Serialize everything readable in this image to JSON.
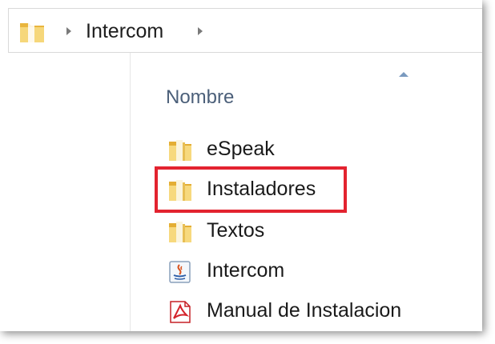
{
  "breadcrumb": {
    "current": "Intercom"
  },
  "list": {
    "column_header": "Nombre",
    "items": [
      {
        "name": "eSpeak",
        "icon": "folder-icon"
      },
      {
        "name": "Instaladores",
        "icon": "folder-icon",
        "highlighted": true
      },
      {
        "name": "Textos",
        "icon": "folder-icon"
      },
      {
        "name": "Intercom",
        "icon": "java-jar-icon"
      },
      {
        "name": "Manual de Instalacion",
        "icon": "pdf-icon"
      }
    ]
  },
  "colors": {
    "highlight": "#e3232f",
    "header_text": "#4c607a"
  }
}
